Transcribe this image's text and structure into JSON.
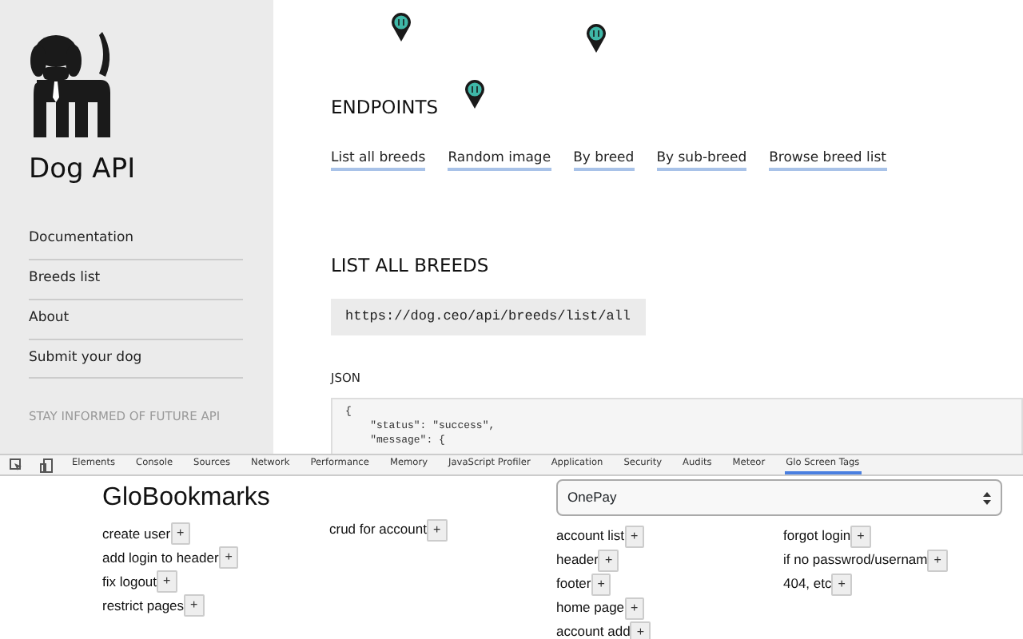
{
  "sidebar": {
    "title": "Dog API",
    "nav": [
      {
        "label": "Documentation"
      },
      {
        "label": "Breeds list"
      },
      {
        "label": "About"
      },
      {
        "label": "Submit your dog"
      }
    ],
    "newsletter_heading": "STAY INFORMED OF FUTURE API"
  },
  "main": {
    "endpoints_heading": "ENDPOINTS",
    "endpoint_links": [
      "List all breeds",
      "Random image",
      "By breed",
      "By sub-breed",
      "Browse breed list"
    ],
    "section_heading": "LIST ALL BREEDS",
    "url": "https://dog.ceo/api/breeds/list/all",
    "json_label": "JSON",
    "json_lines": [
      "{",
      "    \"status\": \"success\",",
      "    \"message\": {"
    ]
  },
  "devtools_tabs": [
    {
      "label": "Elements",
      "selected": false
    },
    {
      "label": "Console",
      "selected": false
    },
    {
      "label": "Sources",
      "selected": false
    },
    {
      "label": "Network",
      "selected": false
    },
    {
      "label": "Performance",
      "selected": false
    },
    {
      "label": "Memory",
      "selected": false
    },
    {
      "label": "JavaScript Profiler",
      "selected": false
    },
    {
      "label": "Application",
      "selected": false
    },
    {
      "label": "Security",
      "selected": false
    },
    {
      "label": "Audits",
      "selected": false
    },
    {
      "label": "Meteor",
      "selected": false
    },
    {
      "label": "Glo Screen Tags",
      "selected": true
    }
  ],
  "bookmarks": {
    "title": "GloBookmarks",
    "project_select": "OnePay",
    "columns": [
      [
        {
          "text": "create user",
          "button": "+"
        },
        {
          "text": "add login to header",
          "button": "+"
        },
        {
          "text": "fix logout",
          "button": "+"
        },
        {
          "text": "restrict pages",
          "button": "+"
        }
      ],
      [
        {
          "text": "crud for account",
          "button": "+"
        }
      ],
      [
        {
          "text": "account list",
          "button": "+"
        },
        {
          "text": "header",
          "button": "+"
        },
        {
          "text": "footer",
          "button": "+"
        },
        {
          "text": "home page",
          "button": "+"
        },
        {
          "text": "account add",
          "button": "+"
        }
      ],
      [
        {
          "text": "forgot login",
          "button": "+"
        },
        {
          "text": "if no passwrod/usernam",
          "button": "+"
        },
        {
          "text": "404, etc",
          "button": "+"
        }
      ]
    ]
  }
}
